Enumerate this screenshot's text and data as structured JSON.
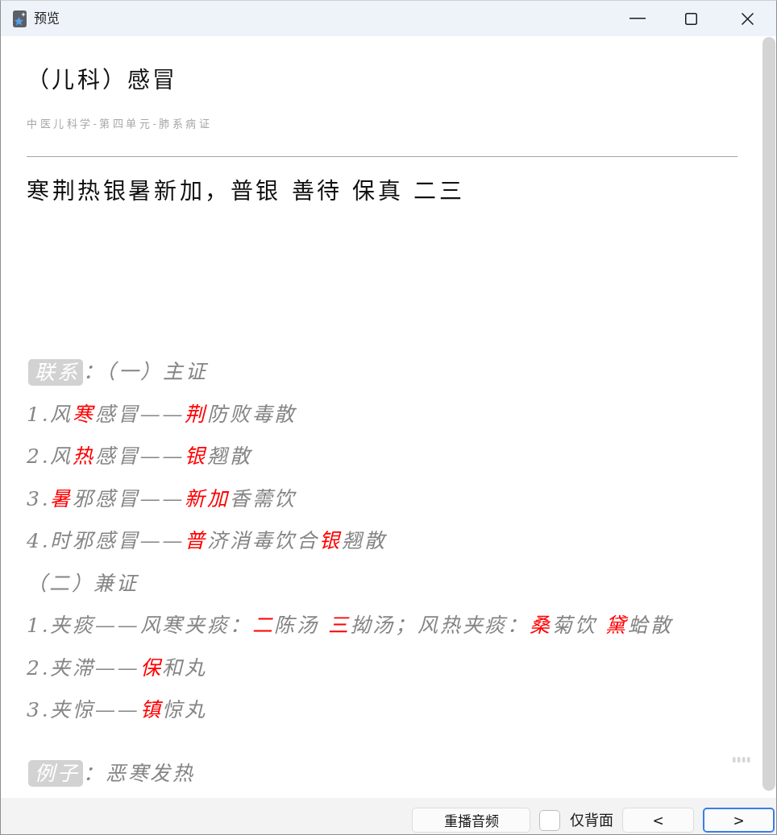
{
  "window": {
    "title": "预览"
  },
  "card": {
    "title": "（儿科）感冒",
    "subtitle": "中医儿科学-第四单元-肺系病证",
    "front": "寒荆热银暑新加，普银 善待 保真 二三"
  },
  "sections": [
    {
      "label": "联系",
      "lines": [
        {
          "segments": [
            {
              "text": "：（一）主证",
              "highlighted": false
            }
          ]
        },
        {
          "segments": [
            {
              "text": "1.风",
              "highlighted": false
            },
            {
              "text": "寒",
              "highlighted": true
            },
            {
              "text": "感冒——",
              "highlighted": false
            },
            {
              "text": "荆",
              "highlighted": true
            },
            {
              "text": "防败毒散",
              "highlighted": false
            }
          ]
        },
        {
          "segments": [
            {
              "text": "2.风",
              "highlighted": false
            },
            {
              "text": "热",
              "highlighted": true
            },
            {
              "text": "感冒——",
              "highlighted": false
            },
            {
              "text": "银",
              "highlighted": true
            },
            {
              "text": "翘散",
              "highlighted": false
            }
          ]
        },
        {
          "segments": [
            {
              "text": "3.",
              "highlighted": false
            },
            {
              "text": "暑",
              "highlighted": true
            },
            {
              "text": "邪感冒——",
              "highlighted": false
            },
            {
              "text": "新加",
              "highlighted": true
            },
            {
              "text": "香薷饮",
              "highlighted": false
            }
          ]
        },
        {
          "segments": [
            {
              "text": "4.时邪感冒——",
              "highlighted": false
            },
            {
              "text": "普",
              "highlighted": true
            },
            {
              "text": "济消毒饮合",
              "highlighted": false
            },
            {
              "text": "银",
              "highlighted": true
            },
            {
              "text": "翘散",
              "highlighted": false
            }
          ]
        },
        {
          "segments": [
            {
              "text": "（二）兼证",
              "highlighted": false
            }
          ]
        },
        {
          "segments": [
            {
              "text": "1.夹痰——风寒夹痰：",
              "highlighted": false
            },
            {
              "text": "二",
              "highlighted": true
            },
            {
              "text": "陈汤 ",
              "highlighted": false
            },
            {
              "text": "三",
              "highlighted": true
            },
            {
              "text": "拗汤；风热夹痰：",
              "highlighted": false
            },
            {
              "text": "桑",
              "highlighted": true
            },
            {
              "text": "菊饮 ",
              "highlighted": false
            },
            {
              "text": "黛",
              "highlighted": true
            },
            {
              "text": "蛤散",
              "highlighted": false
            }
          ]
        },
        {
          "segments": [
            {
              "text": "2.夹滞——",
              "highlighted": false
            },
            {
              "text": "保",
              "highlighted": true
            },
            {
              "text": "和丸",
              "highlighted": false
            }
          ]
        },
        {
          "segments": [
            {
              "text": "3.夹惊——",
              "highlighted": false
            },
            {
              "text": "镇",
              "highlighted": true
            },
            {
              "text": "惊丸",
              "highlighted": false
            }
          ]
        }
      ]
    },
    {
      "label": "例子",
      "lines": [
        {
          "segments": [
            {
              "text": "：恶寒发热",
              "highlighted": false
            }
          ]
        }
      ]
    }
  ],
  "bottom_bar": {
    "replay_button": {
      "label": "重播音频"
    },
    "back_only": {
      "label": "仅背面",
      "checked": false
    },
    "nav_buttons": [
      {
        "label": "<",
        "focused": false
      },
      {
        "label": ">",
        "focused": true
      }
    ]
  }
}
